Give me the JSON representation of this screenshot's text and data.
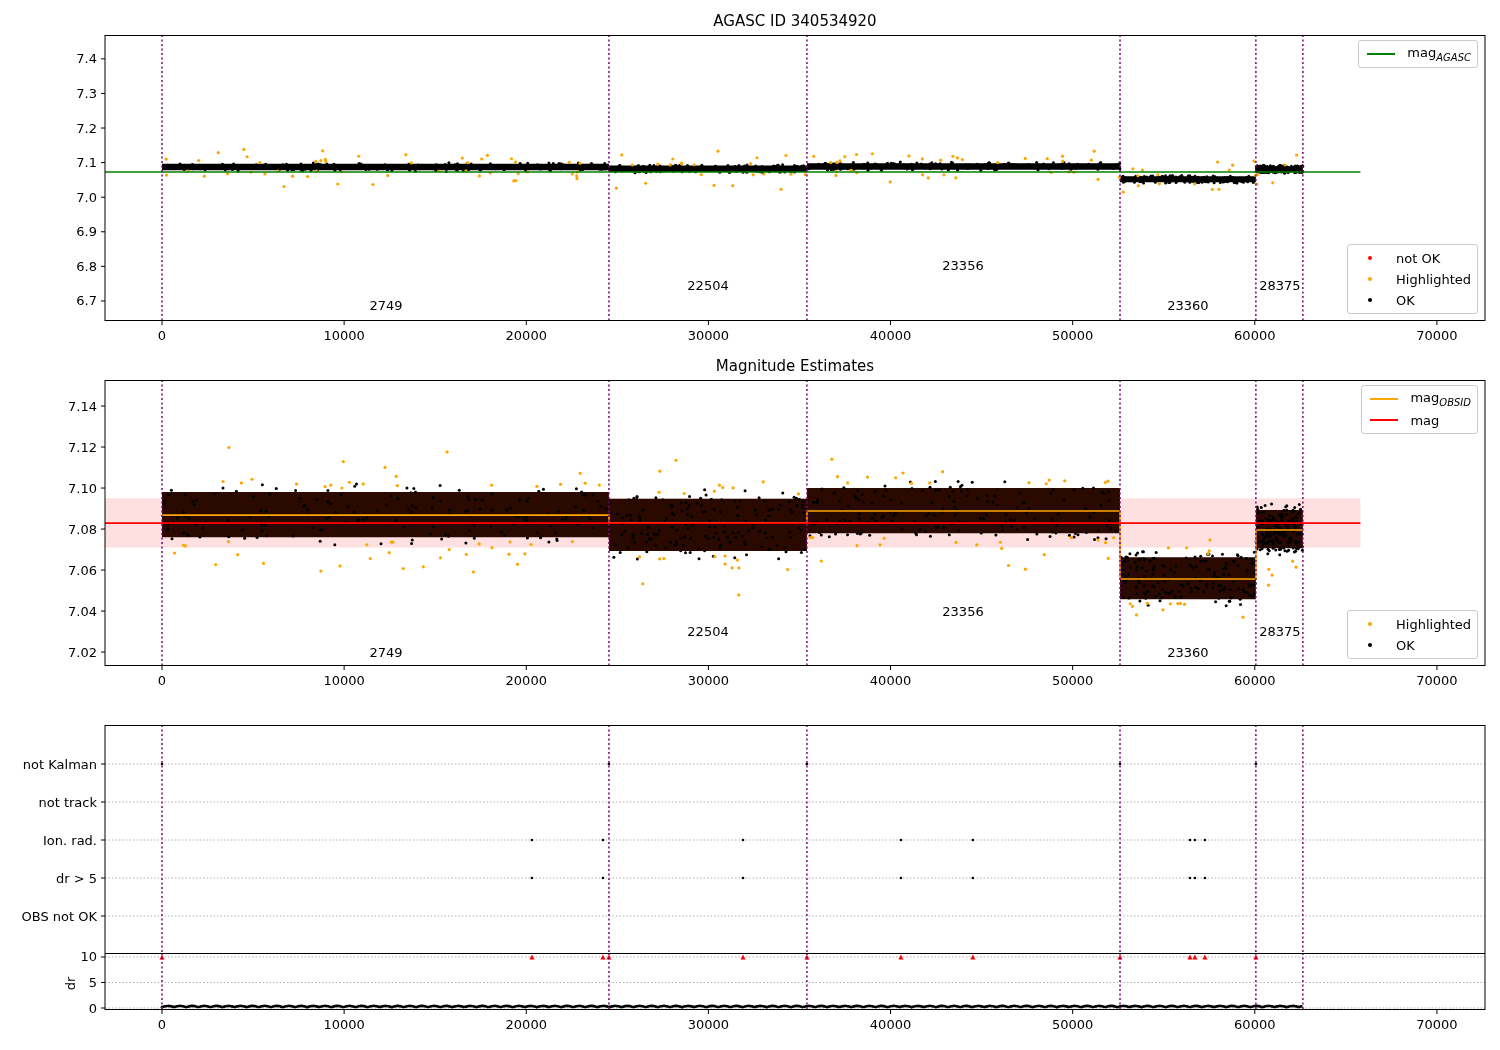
{
  "figure": {
    "panels": [
      {
        "kind": "magnitude",
        "title": "AGASC ID 340534920",
        "point_legend": [
          {
            "label": "not OK",
            "color": "#ff0000"
          },
          {
            "label": "Highlighted",
            "color": "#ffa500"
          },
          {
            "label": "OK",
            "color": "#000000"
          }
        ],
        "chart_data": {
          "type": "line",
          "xlim": [
            -3130,
            72640
          ],
          "ylim": [
            6.642,
            7.469
          ],
          "xticks": [
            0,
            10000,
            20000,
            30000,
            40000,
            50000,
            60000,
            70000
          ],
          "yticks": [
            {
              "value": 6.7,
              "label": "6.7"
            },
            {
              "value": 6.8,
              "label": "6.8"
            },
            {
              "value": 6.9,
              "label": "6.9"
            },
            {
              "value": 7.0,
              "label": "7.0"
            },
            {
              "value": 7.1,
              "label": "7.1"
            },
            {
              "value": 7.2,
              "label": "7.2"
            },
            {
              "value": 7.3,
              "label": "7.3"
            },
            {
              "value": 7.4,
              "label": "7.4"
            }
          ],
          "series": [
            {
              "name": "mag$_{AGASC}$",
              "color": "#008000",
              "x": [
                -3130,
                65800
              ],
              "values": [
                7.073,
                7.073
              ]
            }
          ],
          "annotations": [
            "2749",
            "22504",
            "23356",
            "23360",
            "28375"
          ]
        }
      },
      {
        "kind": "magnitude",
        "title": "Magnitude Estimates",
        "point_legend": [
          {
            "label": "Highlighted",
            "color": "#ffa500"
          },
          {
            "label": "OK",
            "color": "#000000"
          }
        ],
        "chart_data": {
          "type": "line",
          "xlim": [
            -3130,
            72640
          ],
          "ylim": [
            7.0132,
            7.1527
          ],
          "xticks": [
            0,
            10000,
            20000,
            30000,
            40000,
            50000,
            60000,
            70000
          ],
          "yticks": [
            {
              "value": 7.02,
              "label": "7.02"
            },
            {
              "value": 7.04,
              "label": "7.04"
            },
            {
              "value": 7.06,
              "label": "7.06"
            },
            {
              "value": 7.08,
              "label": "7.08"
            },
            {
              "value": 7.1,
              "label": "7.10"
            },
            {
              "value": 7.12,
              "label": "7.12"
            },
            {
              "value": 7.14,
              "label": "7.14"
            }
          ],
          "series": [
            {
              "name": "mag$_{OBSID}$",
              "color": "#ffa500",
              "x": [
                0,
                24540,
                24540,
                35410,
                35410,
                52600,
                52600,
                60060,
                60060,
                62640
              ],
              "values": [
                7.0868,
                7.0868,
                7.083,
                7.083,
                7.0888,
                7.0888,
                7.0556,
                7.0556,
                7.0795,
                7.0795
              ]
            },
            {
              "name": "mag",
              "color": "#ff0000",
              "x": [
                -3130,
                65800
              ],
              "values": [
                7.0829,
                7.0829
              ]
            }
          ],
          "bands": [
            {
              "axis": "y",
              "from": 7.071,
              "to": 7.095
            }
          ],
          "annotations": [
            "2749",
            "22504",
            "23356",
            "23360",
            "28375"
          ]
        }
      },
      {
        "kind": "flags",
        "flag_labels": [
          "not Kalman",
          "not track",
          "Ion. rad.",
          "dr > 5",
          "OBS not OK"
        ]
      },
      {
        "kind": "dr",
        "chart_data": {
          "type": "scatter",
          "ylabel": "dr",
          "xlim": [
            -3130,
            72640
          ],
          "ylim": [
            -0.39,
            10.78
          ],
          "grid": true,
          "xticks": [
            0,
            10000,
            20000,
            30000,
            40000,
            50000,
            60000,
            70000
          ],
          "yticks": [
            0,
            5,
            10
          ],
          "series": [
            {
              "color": "#ff0000",
              "x": [
                0,
                20310,
                24210,
                24540,
                31900,
                35410,
                40570,
                44520,
                52600,
                56440,
                56710,
                57260,
                60060
              ],
              "values": [
                10,
                10,
                10,
                10,
                10,
                10,
                10,
                10,
                10,
                10,
                10,
                10,
                10
              ]
            }
          ]
        }
      }
    ]
  }
}
